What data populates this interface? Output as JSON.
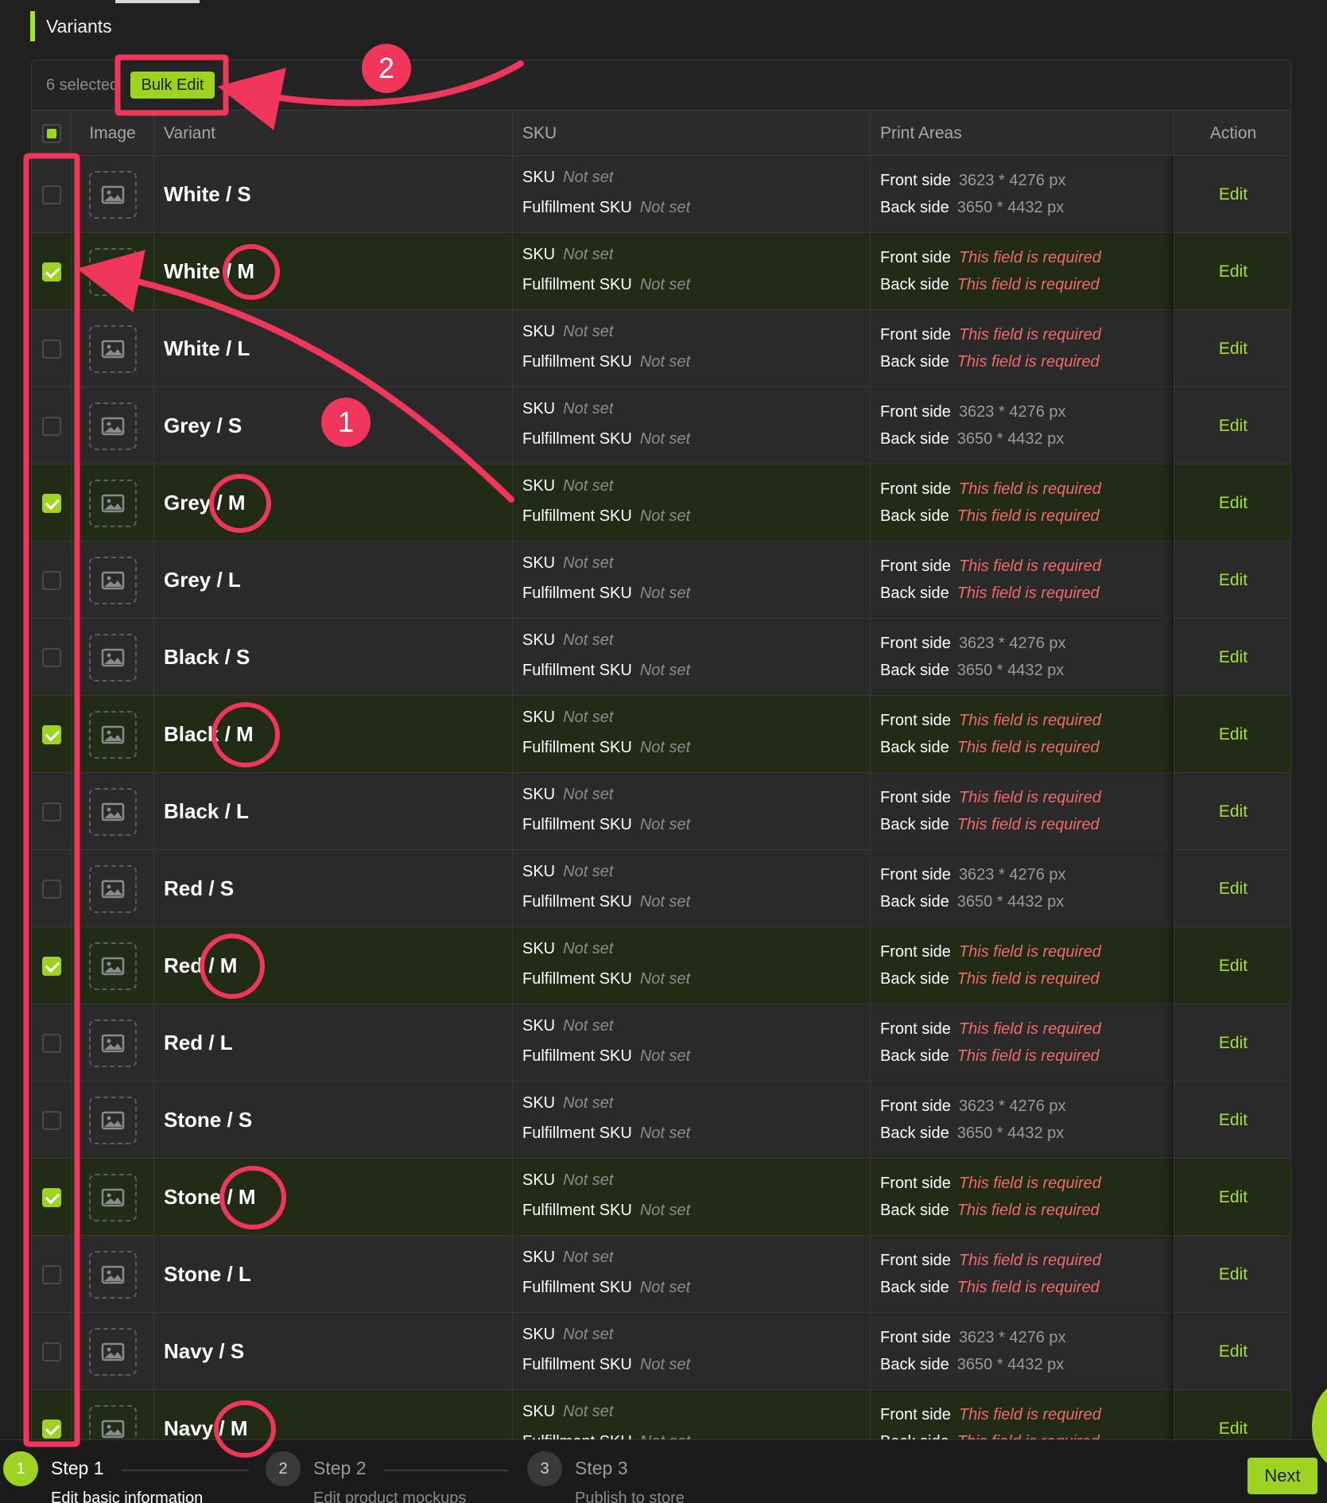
{
  "section": {
    "title": "Variants"
  },
  "toolbar": {
    "selected_count": "6 selected",
    "bulk_edit_label": "Bulk Edit"
  },
  "table": {
    "columns": {
      "image": "Image",
      "variant": "Variant",
      "sku": "SKU",
      "print_areas": "Print Areas",
      "action": "Action"
    },
    "labels": {
      "sku": "SKU",
      "fulfillment_sku": "Fulfillment SKU",
      "front_side": "Front side",
      "back_side": "Back side",
      "edit": "Edit"
    },
    "rows": [
      {
        "variant": "White / S",
        "selected": false,
        "sku": "Not set",
        "fulfillment_sku": "Not set",
        "front": "3623 * 4276 px",
        "back": "3650 * 4432 px",
        "front_required": false,
        "back_required": false
      },
      {
        "variant": "White / M",
        "selected": true,
        "sku": "Not set",
        "fulfillment_sku": "Not set",
        "front": "This field is required",
        "back": "This field is required",
        "front_required": true,
        "back_required": true
      },
      {
        "variant": "White / L",
        "selected": false,
        "sku": "Not set",
        "fulfillment_sku": "Not set",
        "front": "This field is required",
        "back": "This field is required",
        "front_required": true,
        "back_required": true
      },
      {
        "variant": "Grey / S",
        "selected": false,
        "sku": "Not set",
        "fulfillment_sku": "Not set",
        "front": "3623 * 4276 px",
        "back": "3650 * 4432 px",
        "front_required": false,
        "back_required": false
      },
      {
        "variant": "Grey / M",
        "selected": true,
        "sku": "Not set",
        "fulfillment_sku": "Not set",
        "front": "This field is required",
        "back": "This field is required",
        "front_required": true,
        "back_required": true
      },
      {
        "variant": "Grey / L",
        "selected": false,
        "sku": "Not set",
        "fulfillment_sku": "Not set",
        "front": "This field is required",
        "back": "This field is required",
        "front_required": true,
        "back_required": true
      },
      {
        "variant": "Black / S",
        "selected": false,
        "sku": "Not set",
        "fulfillment_sku": "Not set",
        "front": "3623 * 4276 px",
        "back": "3650 * 4432 px",
        "front_required": false,
        "back_required": false
      },
      {
        "variant": "Black / M",
        "selected": true,
        "sku": "Not set",
        "fulfillment_sku": "Not set",
        "front": "This field is required",
        "back": "This field is required",
        "front_required": true,
        "back_required": true
      },
      {
        "variant": "Black / L",
        "selected": false,
        "sku": "Not set",
        "fulfillment_sku": "Not set",
        "front": "This field is required",
        "back": "This field is required",
        "front_required": true,
        "back_required": true
      },
      {
        "variant": "Red / S",
        "selected": false,
        "sku": "Not set",
        "fulfillment_sku": "Not set",
        "front": "3623 * 4276 px",
        "back": "3650 * 4432 px",
        "front_required": false,
        "back_required": false
      },
      {
        "variant": "Red / M",
        "selected": true,
        "sku": "Not set",
        "fulfillment_sku": "Not set",
        "front": "This field is required",
        "back": "This field is required",
        "front_required": true,
        "back_required": true
      },
      {
        "variant": "Red / L",
        "selected": false,
        "sku": "Not set",
        "fulfillment_sku": "Not set",
        "front": "This field is required",
        "back": "This field is required",
        "front_required": true,
        "back_required": true
      },
      {
        "variant": "Stone / S",
        "selected": false,
        "sku": "Not set",
        "fulfillment_sku": "Not set",
        "front": "3623 * 4276 px",
        "back": "3650 * 4432 px",
        "front_required": false,
        "back_required": false
      },
      {
        "variant": "Stone / M",
        "selected": true,
        "sku": "Not set",
        "fulfillment_sku": "Not set",
        "front": "This field is required",
        "back": "This field is required",
        "front_required": true,
        "back_required": true
      },
      {
        "variant": "Stone / L",
        "selected": false,
        "sku": "Not set",
        "fulfillment_sku": "Not set",
        "front": "This field is required",
        "back": "This field is required",
        "front_required": true,
        "back_required": true
      },
      {
        "variant": "Navy / S",
        "selected": false,
        "sku": "Not set",
        "fulfillment_sku": "Not set",
        "front": "3623 * 4276 px",
        "back": "3650 * 4432 px",
        "front_required": false,
        "back_required": false
      },
      {
        "variant": "Navy / M",
        "selected": true,
        "sku": "Not set",
        "fulfillment_sku": "Not set",
        "front": "This field is required",
        "back": "This field is required",
        "front_required": true,
        "back_required": true
      }
    ]
  },
  "footer": {
    "steps": [
      {
        "num": "1",
        "title": "Step 1",
        "desc": "Edit basic information",
        "active": true
      },
      {
        "num": "2",
        "title": "Step 2",
        "desc": "Edit product mockups",
        "active": false
      },
      {
        "num": "3",
        "title": "Step 3",
        "desc": "Publish to store",
        "active": false
      }
    ],
    "next_label": "Next"
  },
  "annotations": {
    "badge_1": "1",
    "badge_2": "2"
  },
  "colors": {
    "accent": "#9ed321",
    "annotation": "#f0365b",
    "required": "#f06a6a",
    "background": "#202020"
  },
  "icons": {
    "image_placeholder": "image-icon"
  }
}
